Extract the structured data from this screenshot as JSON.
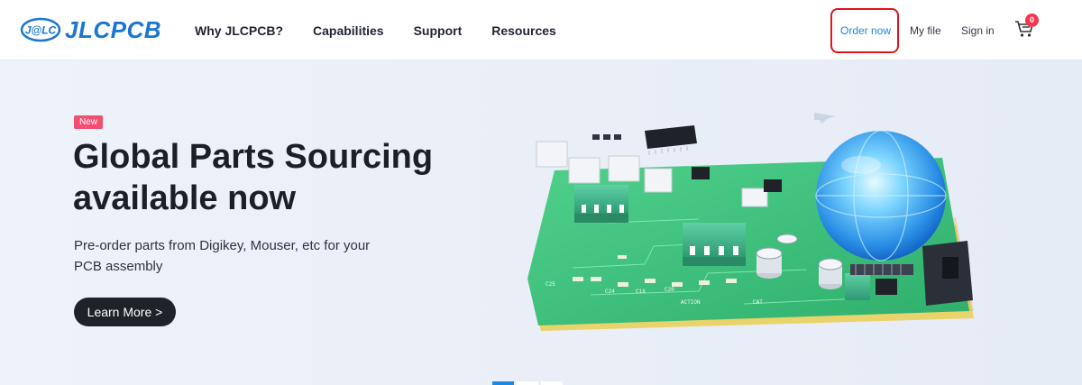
{
  "brand": {
    "badge_text": "J@LC",
    "name": "JLCPCB",
    "color": "#1976d2"
  },
  "nav": {
    "items": [
      {
        "label": "Why JLCPCB?"
      },
      {
        "label": "Capabilities"
      },
      {
        "label": "Support"
      },
      {
        "label": "Resources"
      }
    ]
  },
  "account": {
    "order_now": "Order now",
    "my_file": "My file",
    "sign_in": "Sign in",
    "cart_count": "0",
    "cart_icon": "cart-icon"
  },
  "hero": {
    "badge": "New",
    "title_line1": "Global Parts Sourcing",
    "title_line2": "available now",
    "subtitle_line1": "Pre-order parts from Digikey, Mouser, etc for your",
    "subtitle_line2": "PCB assembly",
    "cta": "Learn More >"
  },
  "carousel": {
    "slides": 3,
    "active_index": 0
  },
  "colors": {
    "accent": "#1e88e5",
    "highlight_box": "#e0141e",
    "badge": "#f24f73",
    "cta_bg": "#1f2329",
    "pcb_green": "#3dbf7a"
  }
}
